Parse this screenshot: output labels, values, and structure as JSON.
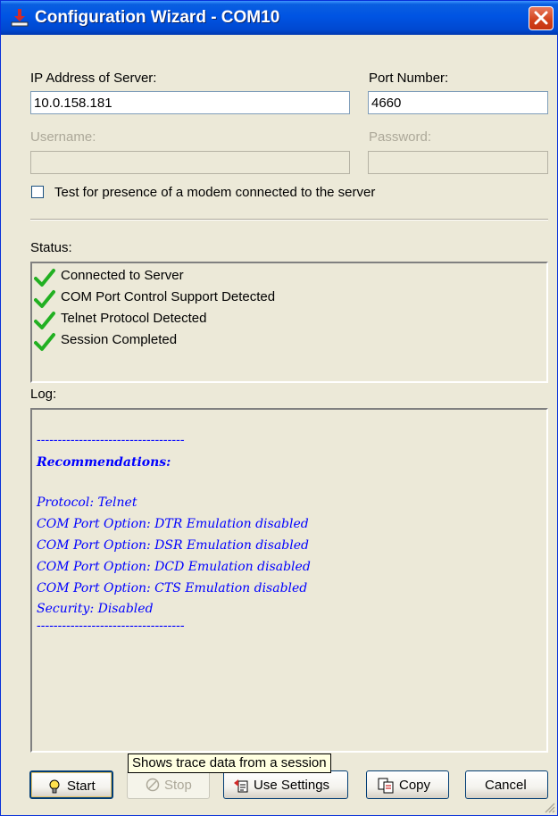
{
  "window": {
    "title": "Configuration Wizard - COM10"
  },
  "fields": {
    "ip_label": "IP Address of Server:",
    "ip_value": "10.0.158.181",
    "port_label": "Port Number:",
    "port_value": "4660",
    "username_label": "Username:",
    "username_value": "",
    "password_label": "Password:",
    "password_value": ""
  },
  "modem_check": {
    "label": "Test for presence of a modem connected to the server",
    "checked": false
  },
  "status": {
    "label": "Status:",
    "items": [
      "Connected to Server",
      "COM Port Control Support Detected",
      "Telnet Protocol Detected",
      "Session Completed"
    ]
  },
  "log": {
    "label": "Log:",
    "lines": [
      "-----------------------------------",
      "Recommendations:",
      "",
      "Protocol: Telnet",
      "COM Port Option: DTR Emulation disabled",
      "COM Port Option: DSR Emulation disabled",
      "COM Port Option: DCD Emulation disabled",
      "COM Port Option: CTS Emulation disabled",
      "Security: Disabled",
      "-----------------------------------"
    ]
  },
  "tooltip": "Shows trace data from a session",
  "buttons": {
    "start": "Start",
    "stop": "Stop",
    "use_settings": "Use Settings",
    "copy": "Copy",
    "cancel": "Cancel"
  },
  "colors": {
    "titlebar": "#0054e3",
    "log_text": "#0000ff",
    "check": "#22b022",
    "dialog_bg": "#ece9d8"
  }
}
